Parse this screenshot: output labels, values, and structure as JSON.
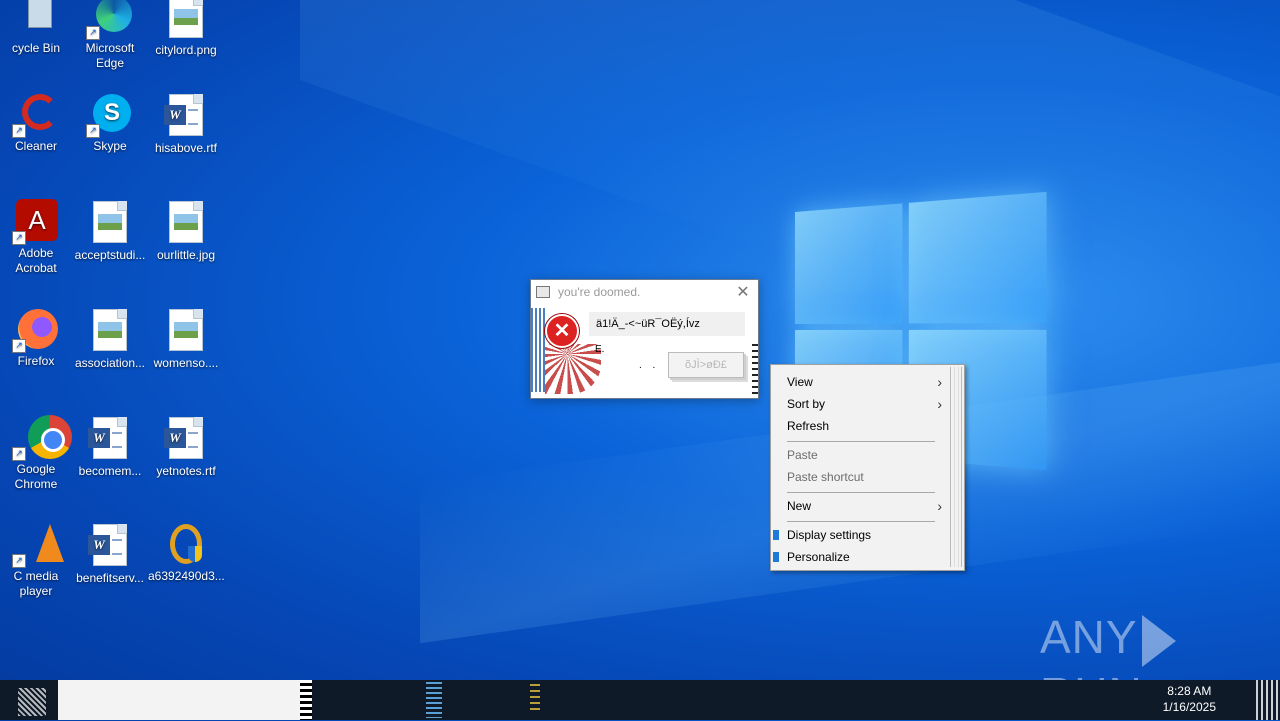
{
  "desktop": {
    "icons": [
      {
        "label": "cycle Bin"
      },
      {
        "label": "Microsoft Edge"
      },
      {
        "label": "citylord.png"
      },
      {
        "label": "Cleaner"
      },
      {
        "label": "Skype"
      },
      {
        "label": "hisabove.rtf"
      },
      {
        "label": "Adobe Acrobat"
      },
      {
        "label": "acceptstudi..."
      },
      {
        "label": "ourlittle.jpg"
      },
      {
        "label": "Firefox"
      },
      {
        "label": "association..."
      },
      {
        "label": "womenso...."
      },
      {
        "label": "Google Chrome"
      },
      {
        "label": "becomem..."
      },
      {
        "label": "yetnotes.rtf"
      },
      {
        "label": "C media player"
      },
      {
        "label": "benefitserv..."
      },
      {
        "label": "a6392490d3..."
      }
    ]
  },
  "dialog": {
    "title": "you're doomed.",
    "close_glyph": "✕",
    "message": "ä1!Ä_-<~üR¯OËý,Ívz",
    "sub": "E.",
    "dots": ". .",
    "button_label": "õJÌ>øÐ£",
    "error_glyph": "✕"
  },
  "context_menu": {
    "items": [
      {
        "label": "View",
        "submenu": true,
        "enabled": true
      },
      {
        "label": "Sort by",
        "submenu": true,
        "enabled": true
      },
      {
        "label": "Refresh",
        "submenu": false,
        "enabled": true
      },
      {
        "label": "Paste",
        "submenu": false,
        "enabled": false
      },
      {
        "label": "Paste shortcut",
        "submenu": false,
        "enabled": false
      },
      {
        "label": "New",
        "submenu": true,
        "enabled": true
      },
      {
        "label": "Display settings",
        "submenu": false,
        "enabled": true
      },
      {
        "label": "Personalize",
        "submenu": false,
        "enabled": true
      }
    ],
    "arrow_glyph": "›"
  },
  "watermark": {
    "left": "ANY",
    "right": "RUN"
  },
  "taskbar": {
    "time": "8:28 AM",
    "date": "1/16/2025"
  },
  "colors": {
    "desktop_blue": "#0a63d8",
    "taskbar": "#0e1a27",
    "error_red": "#d22"
  }
}
